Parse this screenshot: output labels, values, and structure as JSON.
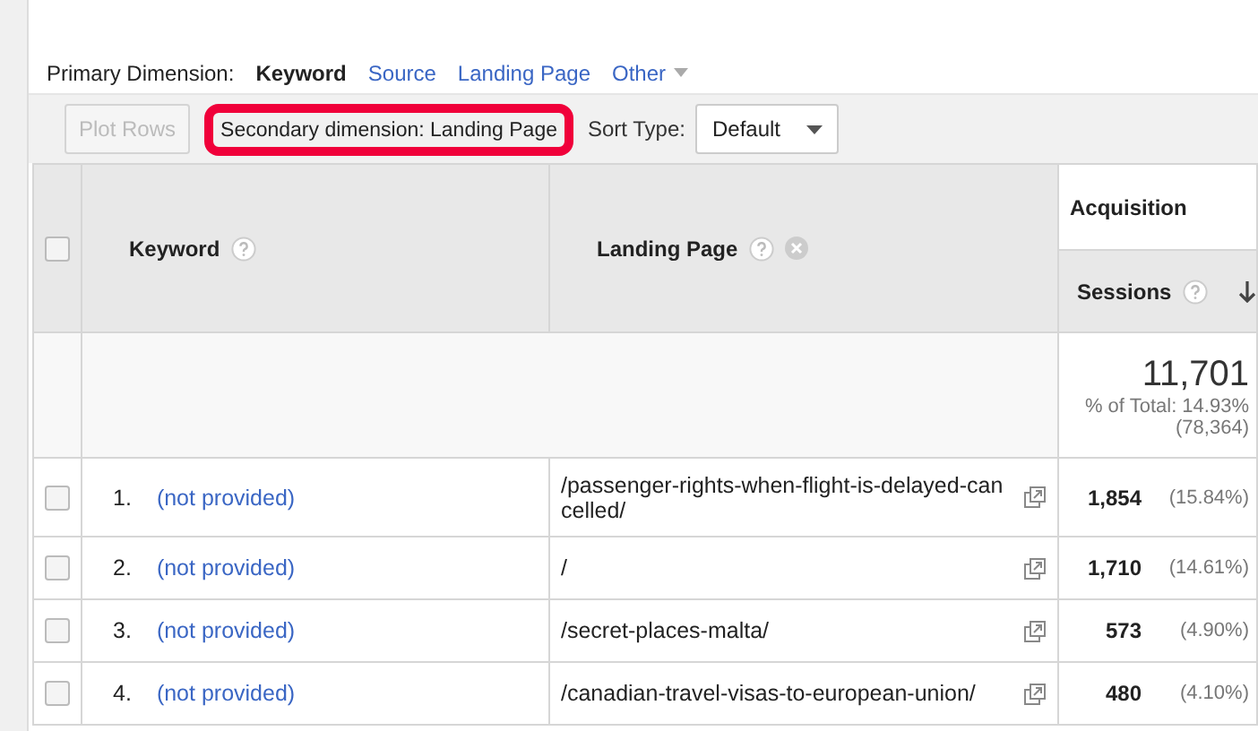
{
  "primary_dimension": {
    "label": "Primary Dimension:",
    "options": [
      {
        "label": "Keyword",
        "selected": true,
        "dropdown": false
      },
      {
        "label": "Source",
        "selected": false,
        "dropdown": false
      },
      {
        "label": "Landing Page",
        "selected": false,
        "dropdown": false
      },
      {
        "label": "Other",
        "selected": false,
        "dropdown": true
      }
    ]
  },
  "toolbar": {
    "plot_rows": {
      "label": "Plot Rows",
      "disabled": true
    },
    "secondary_dimension": "Secondary dimension: Landing Page",
    "sort_type_label": "Sort Type:",
    "sort_type": "Default"
  },
  "table": {
    "header_checkbox": {
      "checked": false
    },
    "columns": [
      {
        "label": "Keyword",
        "kind": "primary"
      },
      {
        "label": "Landing Page",
        "kind": "secondary"
      }
    ],
    "group": "Acquisition",
    "metric": {
      "label": "Sessions"
    },
    "totals": {
      "value": "11,701",
      "share": "% of Total: 14.93%",
      "total": "(78,364)"
    },
    "rows": [
      {
        "checked": false,
        "index": "1.",
        "keyword": "(not provided)",
        "landing_page": "/passenger-rights-when-flight-is-delayed-cancelled/",
        "sessions": "1,854",
        "percent": "(15.84%)"
      },
      {
        "checked": false,
        "index": "2.",
        "keyword": "(not provided)",
        "landing_page": "/",
        "sessions": "1,710",
        "percent": "(14.61%)"
      },
      {
        "checked": false,
        "index": "3.",
        "keyword": "(not provided)",
        "landing_page": "/secret-places-malta/",
        "sessions": "573",
        "percent": "(4.90%)"
      },
      {
        "checked": false,
        "index": "4.",
        "keyword": "(not provided)",
        "landing_page": "/canadian-travel-visas-to-european-union/",
        "sessions": "480",
        "percent": "(4.10%)"
      }
    ]
  }
}
